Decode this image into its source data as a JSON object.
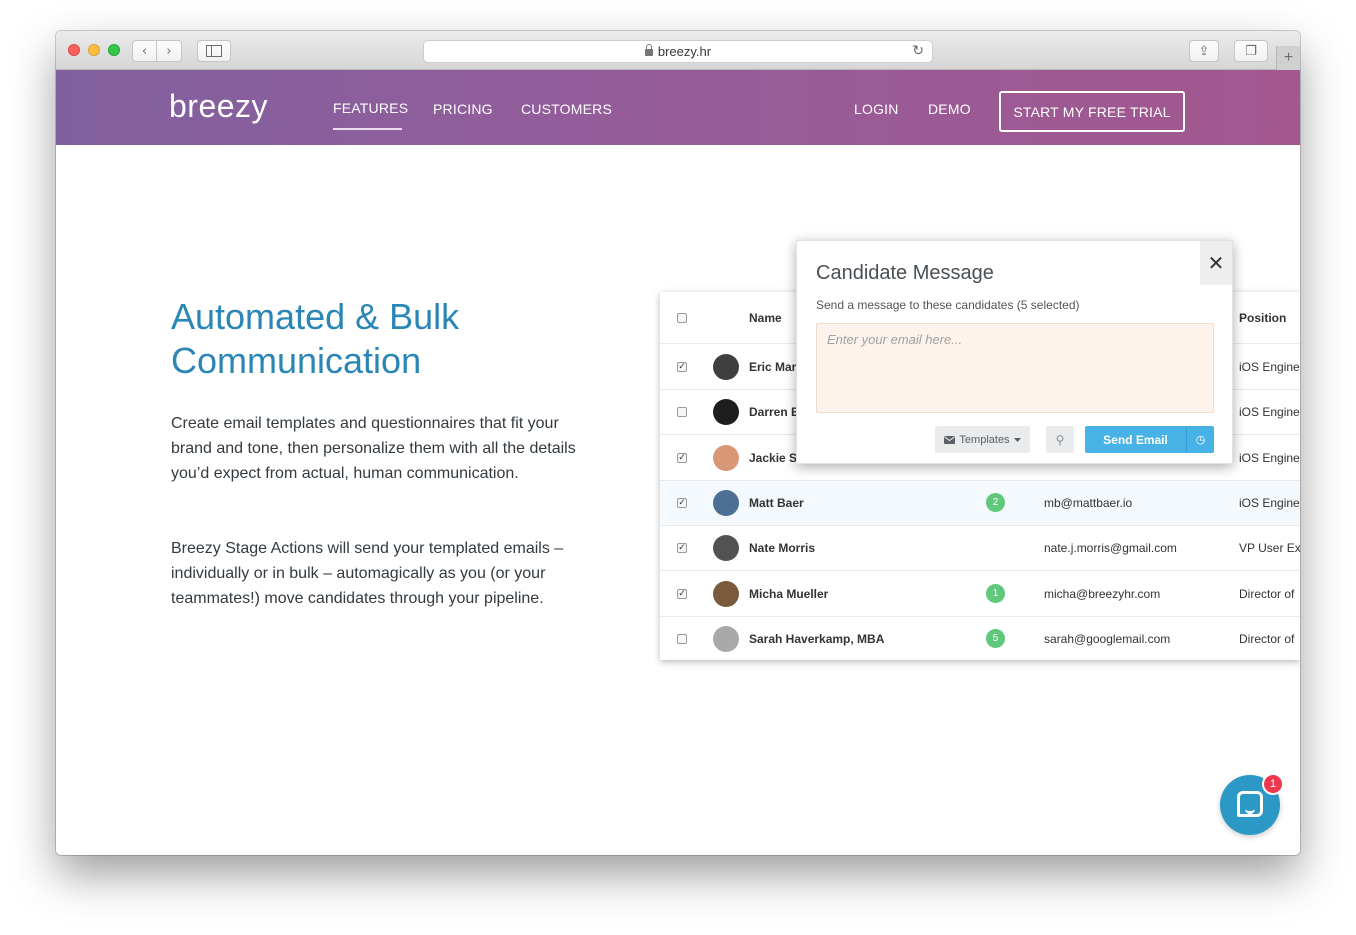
{
  "browser": {
    "url": "breezy.hr",
    "back_glyph": "‹",
    "forward_glyph": "›",
    "reload_glyph": "↻",
    "share_glyph": "⇪",
    "tabs_glyph": "❐",
    "newtab_glyph": "+"
  },
  "nav": {
    "logo": "breezy",
    "links": [
      "FEATURES",
      "PRICING",
      "CUSTOMERS"
    ],
    "login": "LOGIN",
    "demo": "DEMO",
    "cta": "START MY FREE TRIAL"
  },
  "hero": {
    "headline_line1": "Automated & Bulk",
    "headline_line2": "Communication",
    "paragraph1": "Create email templates and questionnaires that fit your brand and tone, then personalize them with all the details you’d expect from actual, human communication.",
    "paragraph2": "Breezy Stage Actions will send your templated emails – individually or in bulk – automagically as you (or your teammates!) move candidates through your pipeline."
  },
  "table": {
    "columns": {
      "name": "Name",
      "position": "Position"
    },
    "rows": [
      {
        "name": "Eric Mar",
        "badge": "",
        "email": "",
        "position": "iOS Engine",
        "checked": true,
        "avatar_color": "#3f3f3f"
      },
      {
        "name": "Darren E",
        "badge": "",
        "email": "",
        "position": "iOS Engine",
        "checked": false,
        "avatar_color": "#1e1e1e"
      },
      {
        "name": "Jackie S",
        "badge": "",
        "email": "",
        "position": "iOS Engine",
        "checked": true,
        "avatar_color": "#d89876"
      },
      {
        "name": "Matt Baer",
        "badge": "2",
        "email": "mb@mattbaer.io",
        "position": "iOS Engine",
        "checked": true,
        "avatar_color": "#4c6f93"
      },
      {
        "name": "Nate Morris",
        "badge": "",
        "email": "nate.j.morris@gmail.com",
        "position": "VP User Ex",
        "checked": true,
        "avatar_color": "#525252"
      },
      {
        "name": "Micha Mueller",
        "badge": "1",
        "email": "micha@breezyhr.com",
        "position": "Director of",
        "checked": true,
        "avatar_color": "#7a5a3c"
      },
      {
        "name": "Sarah Haverkamp, MBA",
        "badge": "5",
        "email": "sarah@googlemail.com",
        "position": "Director of",
        "checked": false,
        "avatar_color": "#a9a9a9"
      }
    ]
  },
  "modal": {
    "title": "Candidate Message",
    "subtitle": "Send a message to these candidates (5 selected)",
    "placeholder": "Enter your email here...",
    "templates_label": "Templates",
    "send_label": "Send Email",
    "close_glyph": "✕",
    "attach_glyph": "⚲",
    "schedule_glyph": "◷"
  },
  "chat": {
    "badge_count": "1"
  },
  "colors": {
    "accent": "#2a86b4",
    "nav_gradient_start": "#82609f",
    "nav_gradient_end": "#a3578f",
    "send_button": "#47b2e6",
    "badge_green": "#5fc87a",
    "chat_bubble": "#2b98c6"
  }
}
